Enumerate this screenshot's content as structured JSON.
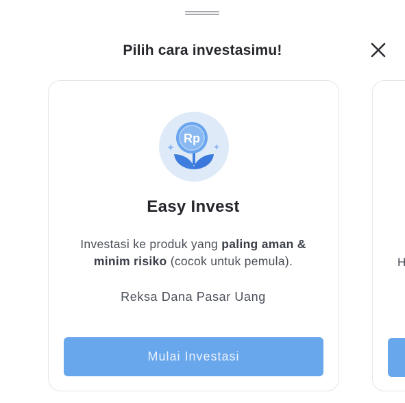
{
  "sheet": {
    "title": "Pilih cara investasimu!"
  },
  "cards": [
    {
      "product_name": "Easy Invest",
      "icon": "rupiah-coin-plant-icon",
      "description": {
        "prefix": "Investasi ke produk yang ",
        "emphasis": "paling aman & minim risiko",
        "suffix": " (cocok untuk pemula)."
      },
      "fund_type": "Reksa Dana Pasar Uang",
      "cta_label": "Mulai Investasi"
    },
    {
      "peek_text": "H"
    }
  ],
  "colors": {
    "primary": "#69a7ec",
    "title_text": "#24262b",
    "body_text": "#4a4e57",
    "card_border": "#e4e5e8",
    "icon_bg": "#dfeaf8"
  }
}
